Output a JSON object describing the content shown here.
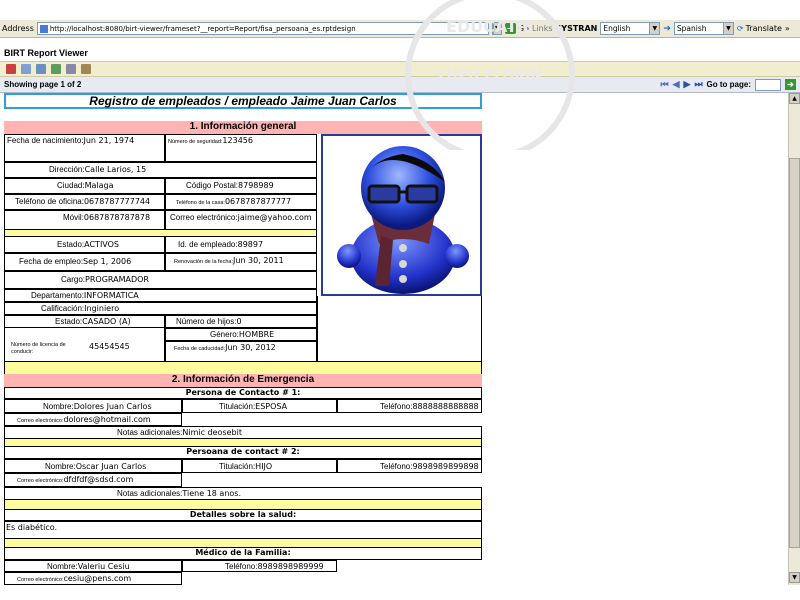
{
  "browser": {
    "address_label": "Address",
    "url": "http://localhost:8080/birt-viewer/frameset?__report=Report/fisa_persoana_es.rptdesign",
    "go_label": "Go",
    "links_label": "Links",
    "translate_brand": "SYSTRAN",
    "from_language": "English",
    "to_language": "Spanish",
    "translate_label": "Translate"
  },
  "viewer": {
    "title": "BIRT Report Viewer",
    "page_status": "Showing page  1  of  2",
    "goto_label": "Go to page:",
    "goto_value": ""
  },
  "watermark": {
    "line1": "EDUCATIE",
    "line2": "LUPU FLORIN"
  },
  "report": {
    "header": "Registro de empleados / empleado   Jaime  Juan   Carlos",
    "section1": "1. Información general",
    "general": {
      "fecha_nac_label": "Fecha de nacimiento:",
      "fecha_nac": "Jun 21, 1974",
      "num_seg_label": "Número de seguridad:",
      "num_seg": "123456",
      "direccion_label": "Dirección:",
      "direccion": "Calle Larios, 15",
      "ciudad_label": "Ciudad:",
      "ciudad": "Malaga",
      "cp_label": "Código Postal:",
      "cp": "8798989",
      "tel_oficina_label": "Teléfono de oficina:",
      "tel_oficina": "0678787777744",
      "tel_casa_label": "Teléfono de la casa:",
      "tel_casa": "0678787877777",
      "movil_label": "Móvil:",
      "movil": "0687878787878",
      "correo_label": "Correo electrónico:",
      "correo": "jaime@yahoo.com"
    },
    "employment": {
      "estado_label": "Estado:",
      "estado": "ACTIVOS",
      "id_label": "Id. de empleado:",
      "id": "89897",
      "fecha_empleo_label": "Fecha de empleo:",
      "fecha_empleo": "Sep 1, 2006",
      "renovacion_label": "Renovación de la fecha:",
      "renovacion": "Jun 30, 2011",
      "cargo_label": "Cargo:",
      "cargo": "PROGRAMADOR",
      "depto_label": "Departamento:",
      "depto": "INFORMATICA",
      "calif_label": "Calificación:",
      "calif": "Inginiero",
      "estado_civil_label": "Estado:",
      "estado_civil": "CASADO (A)",
      "hijos_label": "Número de hijos:",
      "hijos": "0",
      "genero_label": "Género:",
      "genero": "HOMBRE",
      "licencia_label": "Número de licencia de conducir:",
      "licencia": "45454545",
      "caducidad_label": "Fecha de caducidad:",
      "caducidad": "Jun 30, 2012"
    },
    "section2": "2. Información de Emergencia",
    "contact1": {
      "title": "Persona de Contacto # 1:",
      "nombre_label": "Nombre:",
      "nombre": "Dolores Juan Carlos",
      "titulacion_label": "Titulación:",
      "titulacion": "ESPOSA",
      "tel_label": "Teléfono:",
      "tel": "8888888888888",
      "correo_label": "Correo electrónico:",
      "correo": "dolores@hotmail.com",
      "notas_label": "Notas adicionales:",
      "notas": "Nimic deosebit"
    },
    "contact2": {
      "title": "Persoana de contact # 2:",
      "nombre_label": "Nombre:",
      "nombre": "Oscar Juan Carlos",
      "titulacion_label": "Titulación:",
      "titulacion": "HIJO",
      "tel_label": "Teléfono:",
      "tel": "9898989899898",
      "correo_label": "Correo electrónico:",
      "correo": "dfdfdf@sdsd.com",
      "notas_label": "Notas adicionales:",
      "notas": "Tiene 18 anos."
    },
    "salud": {
      "title": "Detalles sobre la salud:",
      "text": "Es diabético."
    },
    "medico": {
      "title": "Médico de la Familia:",
      "nombre_label": "Nombre:",
      "nombre": "Valeriu Cesiu",
      "tel_label": "Teléfono:",
      "tel": "8989898989999",
      "correo_label": "Correo electrónico:",
      "correo": "cesiu@pens.com"
    }
  }
}
